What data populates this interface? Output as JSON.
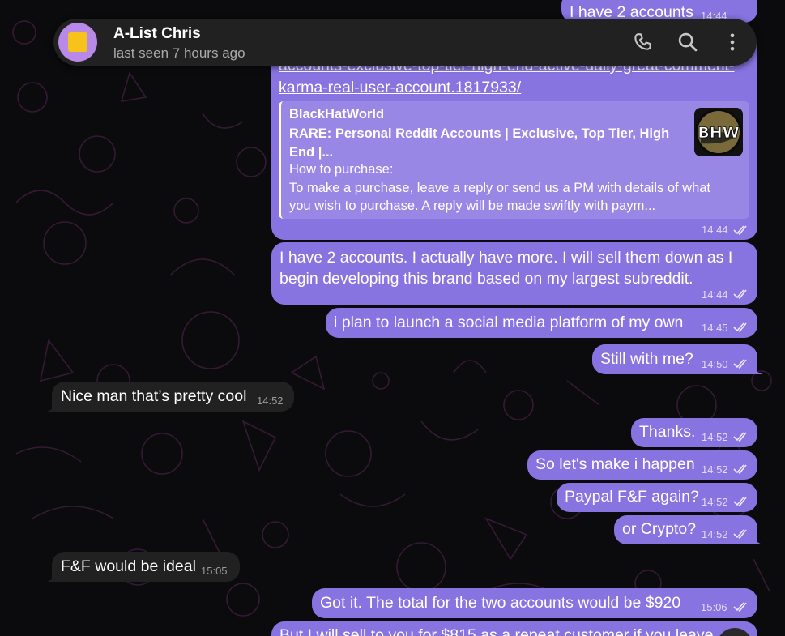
{
  "header": {
    "contact_name": "A-List Chris",
    "status": "last seen 7 hours ago",
    "avatar_colors": {
      "ring": "#b889e6",
      "square": "#f7c21a"
    },
    "icons": [
      "phone-icon",
      "search-icon",
      "more-vertical-icon"
    ]
  },
  "colors": {
    "outgoing_bubble": "#8774e1",
    "incoming_bubble": "#212121",
    "header": "#212121",
    "background": "#0b0a0d"
  },
  "messages": {
    "m0": {
      "text": "I have 2 accounts",
      "time": "14:44"
    },
    "m1": {
      "link_line1": "accounts-exclusive-top-tier-high-end-active-daily-great-comment-",
      "link_line2": "karma-real-user-account.1817933/",
      "preview_site": "BlackHatWorld",
      "preview_title_1": "RARE: Personal Reddit Accounts | Exclusive, Top Tier, High",
      "preview_title_2": "End |...",
      "preview_desc_1": "How to purchase:",
      "preview_desc_2": "To make a purchase, leave a reply or send us a PM with details of what",
      "preview_desc_3": "you wish to purchase.   A reply will be made swiftly with paym...",
      "preview_logo": "BHW",
      "time": "14:44"
    },
    "m2": {
      "line1": "I have 2 accounts.  I actually have more.  I will sell them down as I",
      "line2": "begin developing this brand based on my largest subreddit.",
      "time": "14:44"
    },
    "m3": {
      "text": "i plan to launch a social media platform of my own",
      "time": "14:45"
    },
    "m4": {
      "text": "Still with me?",
      "time": "14:50"
    },
    "m5": {
      "text": "Nice man that’s pretty cool",
      "time": "14:52"
    },
    "m6": {
      "text": "Thanks.",
      "time": "14:52"
    },
    "m7": {
      "text": "So let's make i happen",
      "time": "14:52"
    },
    "m8": {
      "text": "Paypal F&F again?",
      "time": "14:52"
    },
    "m9": {
      "text": "or Crypto?",
      "time": "14:52"
    },
    "m10": {
      "text": "F&F would be ideal",
      "time": "15:05"
    },
    "m11": {
      "text": "Got it.  The total for the two accounts would be $920",
      "time": "15:06"
    },
    "m12": {
      "text": "But I will sell to you for $815 as a repeat customer if you leave"
    }
  }
}
